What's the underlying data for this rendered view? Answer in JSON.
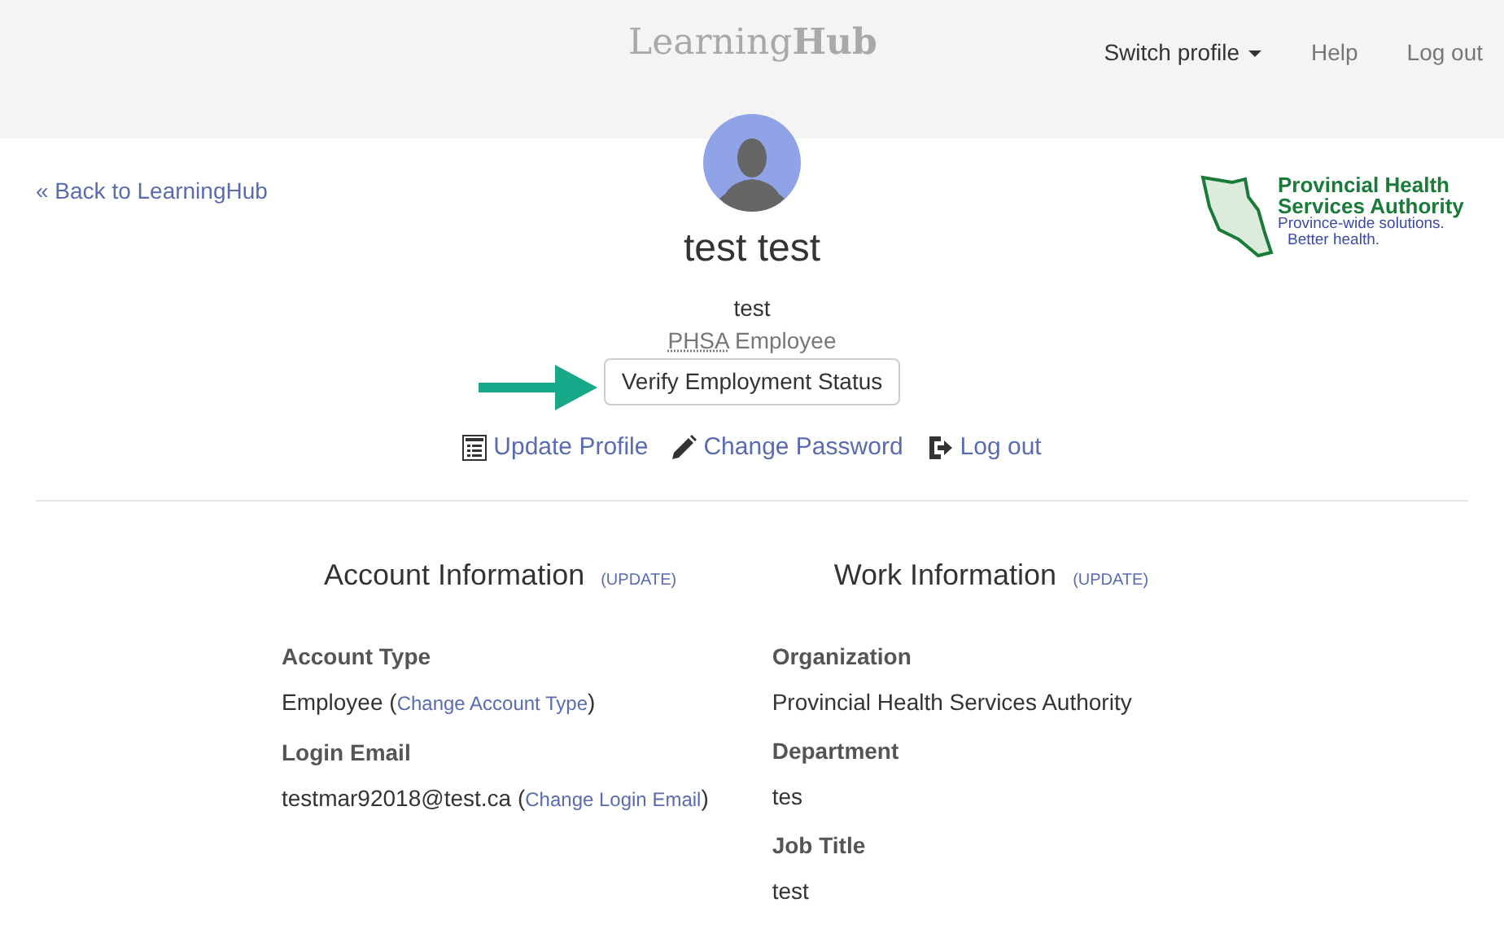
{
  "header": {
    "logo": {
      "light": "Learning",
      "bold": "Hub"
    },
    "nav": [
      {
        "label": "Switch profile",
        "dropdown": true,
        "selected": true
      },
      {
        "label": "Help",
        "dropdown": false,
        "selected": false
      },
      {
        "label": "Log out",
        "dropdown": false,
        "selected": false
      }
    ]
  },
  "back_link": "« Back to LearningHub",
  "org_logo": {
    "lines": [
      "Provincial Health",
      "Services Authority"
    ],
    "tagline": [
      "Province-wide solutions.",
      "Better health."
    ]
  },
  "profile": {
    "name": "test test",
    "username": "test",
    "role": {
      "abbr": "PHSA",
      "text": "Employee"
    },
    "verify_button": "Verify Employment Status",
    "actions": [
      {
        "kind": "list",
        "label": "Update Profile"
      },
      {
        "kind": "pencil",
        "label": "Change Password"
      },
      {
        "kind": "logout",
        "label": "Log out"
      }
    ]
  },
  "sections": [
    {
      "title": "Account Information",
      "update": "(UPDATE)",
      "fields": [
        {
          "label": "Account Type",
          "parts": [
            {
              "text": "Employee (",
              "link": false
            },
            {
              "text": "Change Account Type",
              "link": true
            },
            {
              "text": ")",
              "link": false
            }
          ]
        },
        {
          "label": "Login Email",
          "parts": [
            {
              "text": "testmar92018@test.ca (",
              "link": false
            },
            {
              "text": "Change Login Email",
              "link": true
            },
            {
              "text": ")",
              "link": false
            }
          ]
        }
      ]
    },
    {
      "title": "Work Information",
      "update": "(UPDATE)",
      "fields": [
        {
          "label": "Organization",
          "parts": [
            {
              "text": "Provincial Health Services Authority",
              "link": false
            }
          ]
        },
        {
          "label": "Department",
          "parts": [
            {
              "text": "tes",
              "link": false
            }
          ]
        },
        {
          "label": "Job Title",
          "parts": [
            {
              "text": "test",
              "link": false
            }
          ]
        }
      ]
    }
  ]
}
